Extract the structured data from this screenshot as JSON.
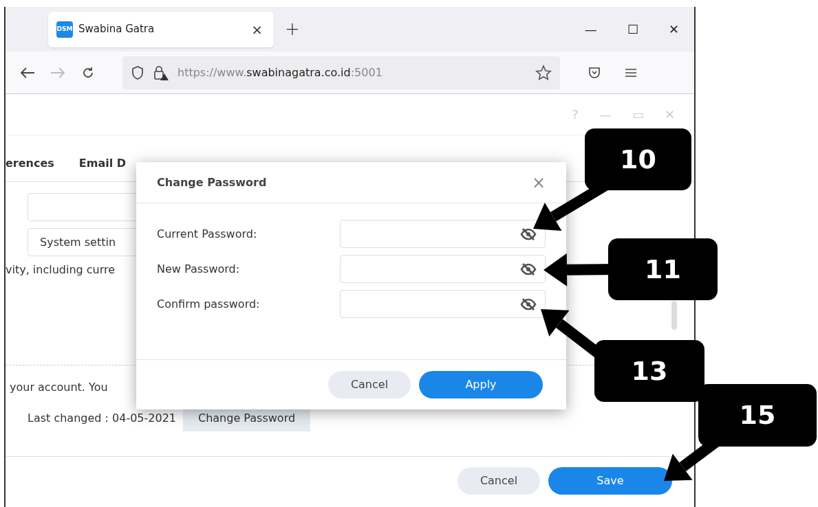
{
  "browser": {
    "tab": {
      "favicon": "DSM",
      "title": "Swabina Gatra",
      "close": "×"
    },
    "new_tab": "+",
    "window_controls": [
      "—",
      "☐",
      "✕"
    ],
    "url": {
      "prefix": "https://www.",
      "domain": "swabinagatra.co.id",
      "suffix": ":5001"
    }
  },
  "app": {
    "title_controls": [
      "?",
      "—",
      "▭",
      "✕"
    ],
    "tabs": [
      {
        "label": "erences"
      },
      {
        "label": "Email D"
      }
    ],
    "select_value": "System settin",
    "description": "vity, including curre",
    "account_text": "your account. You",
    "last_changed": "Last changed : 04-05-2021",
    "change_button": "Change Password",
    "buttons": [
      {
        "label": "Cancel",
        "kind": "secondary"
      },
      {
        "label": "Save",
        "kind": "primary"
      }
    ]
  },
  "dialog": {
    "title": "Change Password",
    "close": "×",
    "fields": [
      {
        "label": "Current Password:",
        "visible": false
      },
      {
        "label": "New Password:",
        "visible": false
      },
      {
        "label": "Confirm password:",
        "visible": false
      }
    ],
    "buttons": [
      {
        "label": "Cancel",
        "kind": "secondary"
      },
      {
        "label": "Apply",
        "kind": "primary"
      }
    ]
  },
  "callouts": [
    {
      "number": "10"
    },
    {
      "number": "11"
    },
    {
      "number": "13"
    },
    {
      "number": "15"
    }
  ]
}
